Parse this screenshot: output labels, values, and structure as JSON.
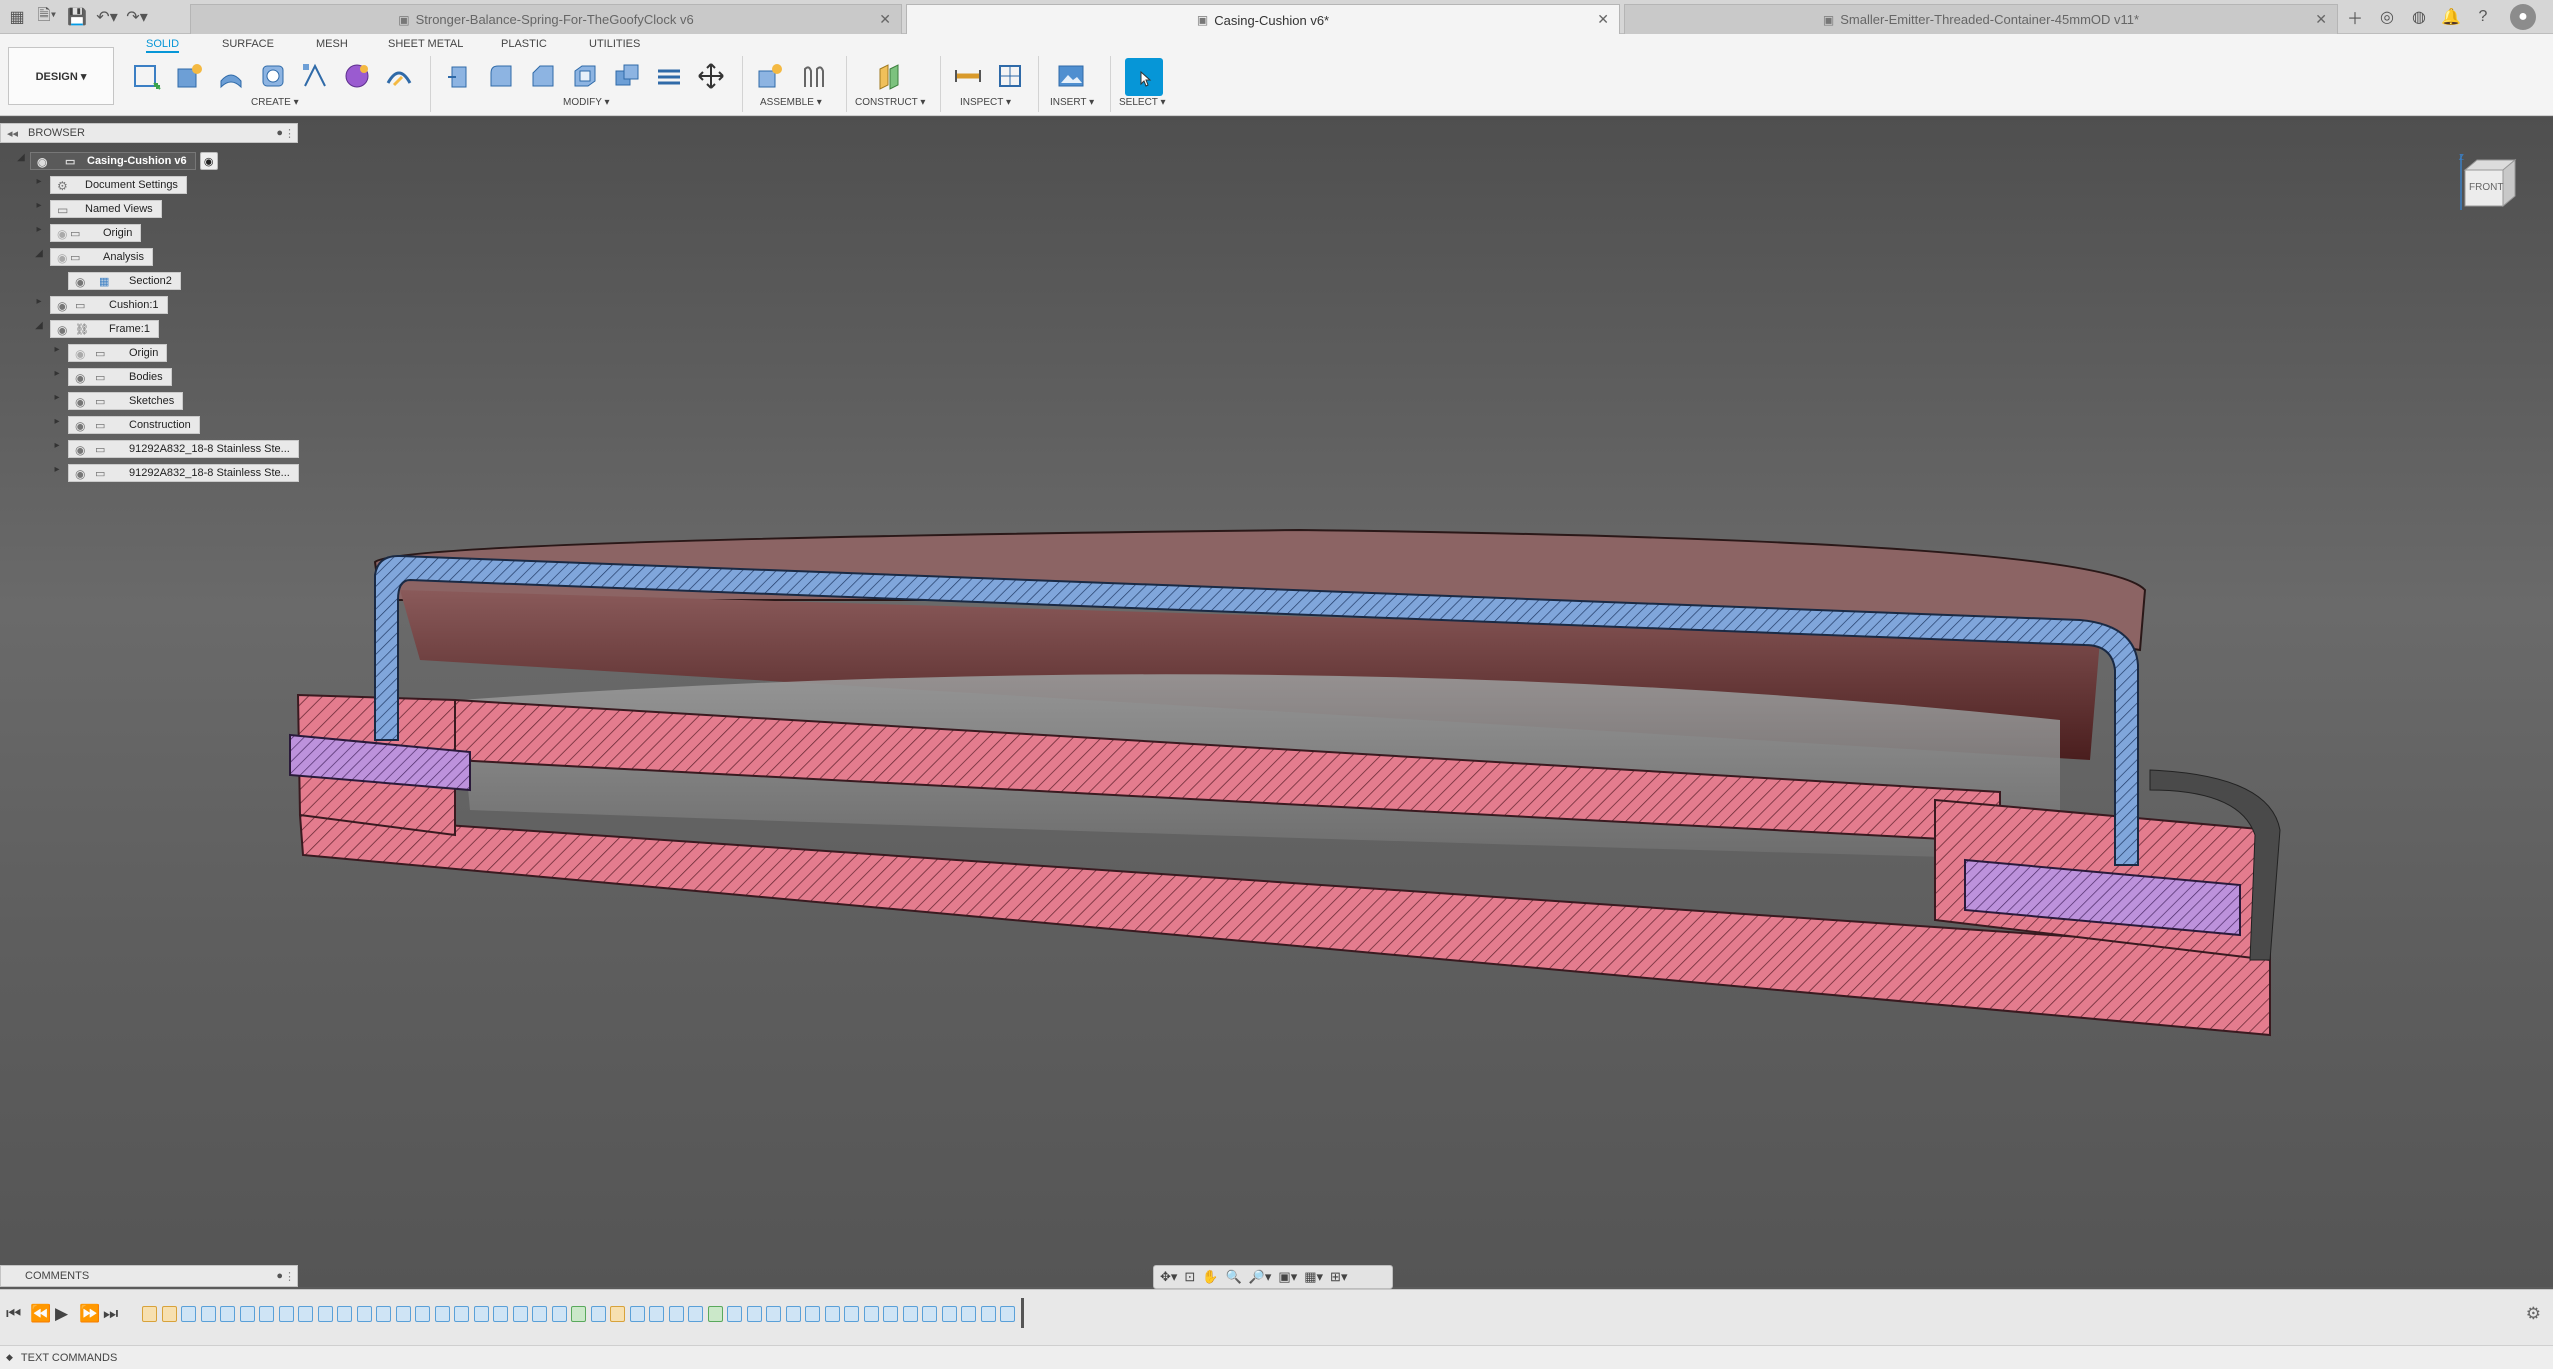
{
  "topbar": {
    "tabs": [
      {
        "label": "Stronger-Balance-Spring-For-TheGoofyClock v6",
        "active": false
      },
      {
        "label": "Casing-Cushion v6*",
        "active": true
      },
      {
        "label": "Smaller-Emitter-Threaded-Container-45mmOD v11*",
        "active": false
      }
    ]
  },
  "ribbon": {
    "workspace": "DESIGN ▾",
    "tabs": [
      "SOLID",
      "SURFACE",
      "MESH",
      "SHEET METAL",
      "PLASTIC",
      "UTILITIES"
    ],
    "groups": [
      "CREATE ▾",
      "MODIFY ▾",
      "ASSEMBLE ▾",
      "CONSTRUCT ▾",
      "INSPECT ▾",
      "INSERT ▾",
      "SELECT ▾"
    ]
  },
  "browser": {
    "title": "BROWSER",
    "root": "Casing-Cushion v6",
    "items": [
      {
        "label": "Document Settings"
      },
      {
        "label": "Named Views"
      },
      {
        "label": "Origin"
      },
      {
        "label": "Analysis"
      },
      {
        "label": "Section2"
      },
      {
        "label": "Cushion:1"
      },
      {
        "label": "Frame:1"
      },
      {
        "label": "Origin"
      },
      {
        "label": "Bodies"
      },
      {
        "label": "Sketches"
      },
      {
        "label": "Construction"
      },
      {
        "label": "91292A832_18-8 Stainless Ste..."
      },
      {
        "label": "91292A832_18-8 Stainless Ste..."
      }
    ]
  },
  "viewcube": {
    "face": "FRONT"
  },
  "comments": {
    "label": "COMMENTS"
  },
  "textcommands": {
    "label": "TEXT COMMANDS"
  },
  "colors": {
    "accent": "#0696d7",
    "section_pink": "#e27b8c",
    "section_blue": "#7aa0d8",
    "section_purple": "#b58ad6"
  }
}
